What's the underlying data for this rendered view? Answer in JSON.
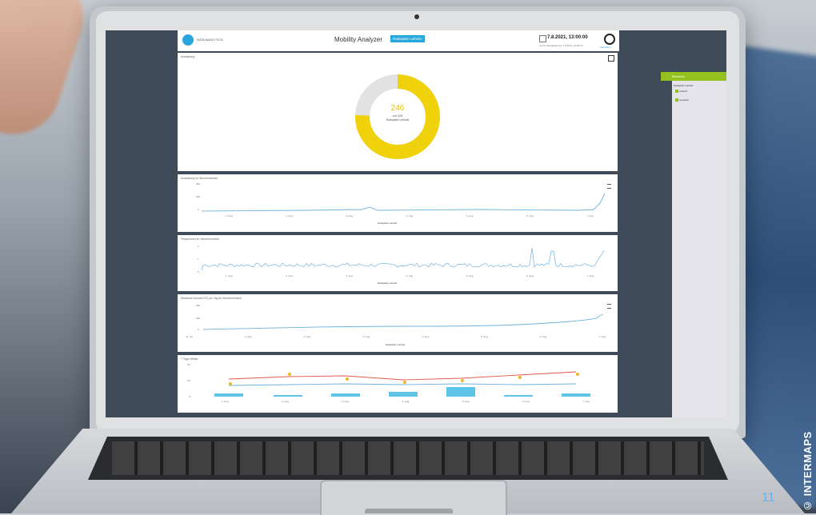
{
  "app": {
    "logo_text": "DATA ANALYTICS",
    "title": "Mobility Analyzer",
    "location": "Radsplatz Leibnitz",
    "datetime": "7.8.2021, 13:00:00",
    "updated": "Letzte Aktualisierung: 7.8.2021, 12:59:15",
    "user_label": "Abmelden"
  },
  "panels": {
    "occupancy": {
      "title": "Auslastung",
      "value": "246",
      "of_text": "von 326",
      "location": "Radsplatz Leibnitz",
      "fraction": 0.755
    },
    "weekly_occupancy": {
      "title": "Auslastung im Wochenverlauf",
      "ylabel": "Auslastung (abs.)",
      "yticks": [
        "400",
        "200",
        "0"
      ],
      "legend": "Radsplatz Leibnitz"
    },
    "frequency": {
      "title": "Frequenzen im Wochenverlauf",
      "ylabel": "KFZ pro Minute",
      "yticks": [
        "2",
        "1",
        "0"
      ],
      "legend": "Radsplatz Leibnitz"
    },
    "max_daily": {
      "title": "Maximale Anzahl KFZ pro Tag im Wochenverlauf",
      "ylabel": "Auslastung (abs.)",
      "yticks": [
        "400",
        "200",
        "0"
      ],
      "legend": "Radsplatz Leibnitz",
      "first_tick": "31. Jul"
    },
    "weather": {
      "title": "7 Tage Wetter",
      "yticks": [
        "50°",
        "30°",
        "0°"
      ]
    }
  },
  "xticks": [
    "1. Aug",
    "2. Aug",
    "3. Aug",
    "4. Aug",
    "5. Aug",
    "6. Aug",
    "7. Aug"
  ],
  "sidebar": {
    "header": "Bereiche",
    "group": "Radsplatz Leibnitz",
    "items": [
      "Leibnitz",
      "Leutasch"
    ]
  },
  "credit": "© INTERMAPS",
  "page_number": "11",
  "colors": {
    "accent": "#26a8dc",
    "gauge": "#f0d20c",
    "green": "#95c11f",
    "line": "#6fb2e0"
  }
}
